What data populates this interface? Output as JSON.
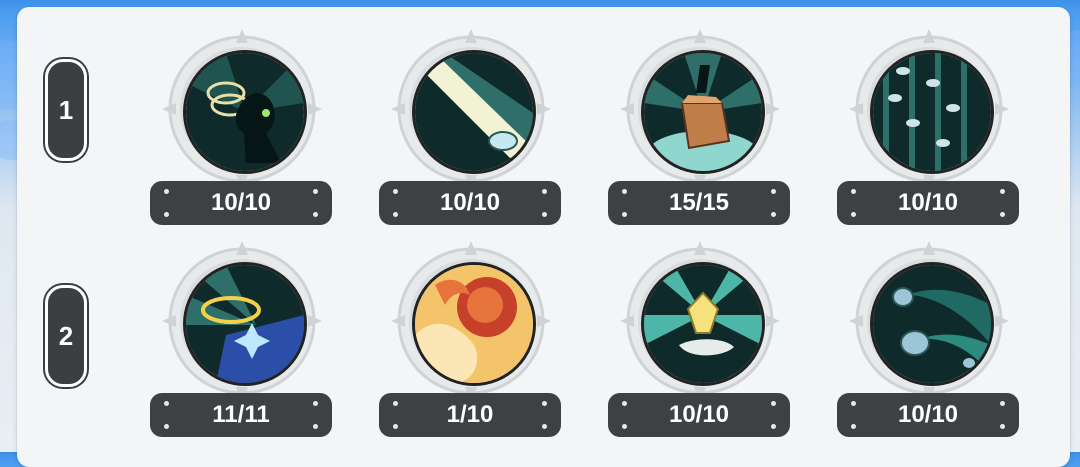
{
  "rows": [
    {
      "label": "1",
      "skills": [
        {
          "count": "10/10",
          "icon": "rings-silhouette-icon"
        },
        {
          "count": "10/10",
          "icon": "light-beam-capsule-icon"
        },
        {
          "count": "15/15",
          "icon": "wooden-block-icon"
        },
        {
          "count": "10/10",
          "icon": "coin-rain-icon"
        }
      ]
    },
    {
      "label": "2",
      "skills": [
        {
          "count": "11/11",
          "icon": "halo-wing-icon"
        },
        {
          "count": "1/10",
          "icon": "fire-blast-icon"
        },
        {
          "count": "10/10",
          "icon": "crystal-hand-icon"
        },
        {
          "count": "10/10",
          "icon": "comet-coins-icon"
        }
      ]
    }
  ],
  "colors": {
    "badge": "#3d4144",
    "art_dark": "#0e2a2a",
    "art_teal": "#4db6a8",
    "frame": "#d5d8da"
  }
}
